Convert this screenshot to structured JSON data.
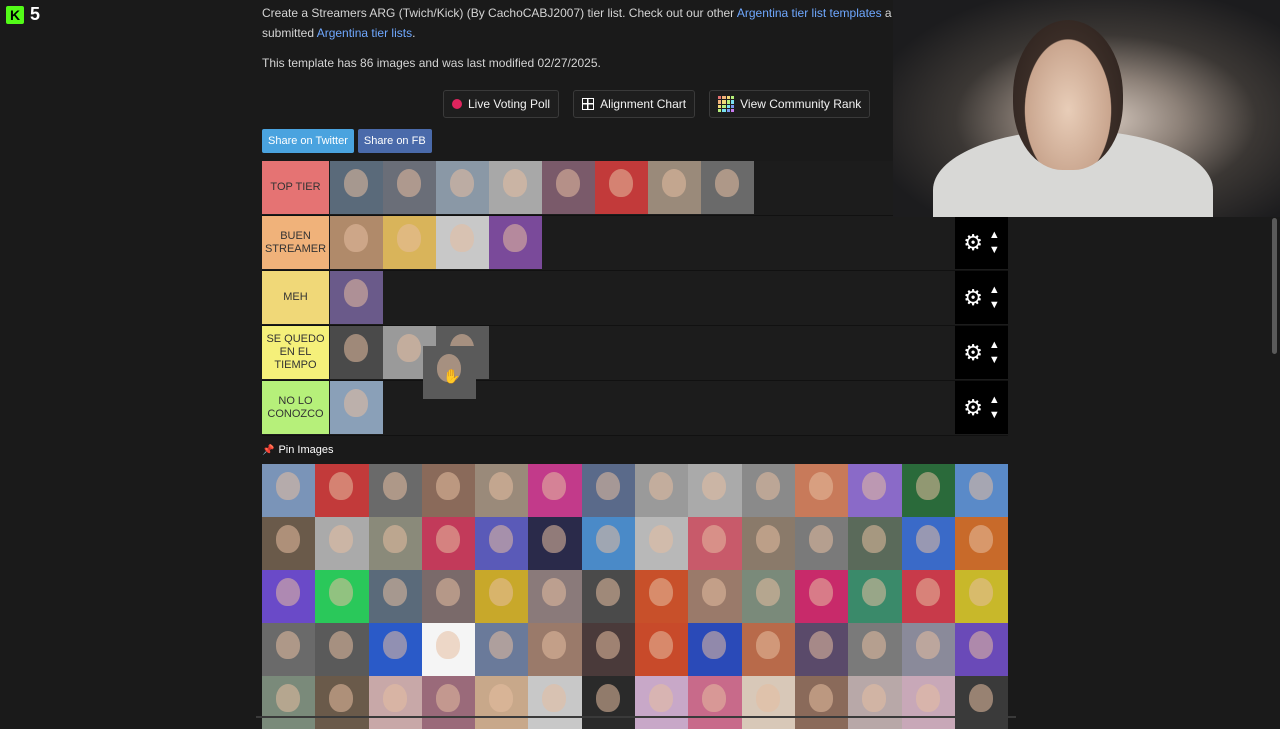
{
  "overlay": {
    "kick_count": "5",
    "kick_logo": "K"
  },
  "description": {
    "prefix": "Create a Streamers ARG (Twich/Kick) (By CachoCABJ2007) tier list. Check out our other ",
    "link1": "Argentina tier list templates",
    "middle": " and the r",
    "line2_prefix": "submitted ",
    "link2": "Argentina tier lists",
    "line2_suffix": "."
  },
  "meta_text": "This template has 86 images and was last modified 02/27/2025.",
  "toolbar": {
    "live_voting": "Live Voting Poll",
    "alignment_chart": "Alignment Chart",
    "community_rank": "View Community Rank"
  },
  "share": {
    "twitter": "Share on Twitter",
    "facebook": "Share on FB"
  },
  "tiers": [
    {
      "label": "TOP TIER",
      "color": "#e57373",
      "items": [
        "#5a6a7a",
        "#6a6e78",
        "#8a98a6",
        "#a8a8a8",
        "#7a5a6a",
        "#c23a3a",
        "#9a8a7a",
        "#6a6a6a"
      ]
    },
    {
      "label": "BUEN STREAMER",
      "color": "#f0b27a",
      "items": [
        "#b08a6a",
        "#d9b45a",
        "#c8c8c8",
        "#7a4a9a"
      ]
    },
    {
      "label": "MEH",
      "color": "#f0d878",
      "items": [
        "#6a5a8a"
      ]
    },
    {
      "label": "SE QUEDO EN EL TIEMPO",
      "color": "#f5f07a",
      "items": [
        "#4a4a4a",
        "#9a9a9a",
        "#5a5a5a"
      ]
    },
    {
      "label": "NO LO CONOZCO",
      "color": "#b6f07a",
      "items": [
        "#8aa0b8"
      ]
    }
  ],
  "pin_title": "Pin Images",
  "pool_colors": [
    "#7a94b8",
    "#c23a3a",
    "#6a6a6a",
    "#8a6a5a",
    "#9a8a7a",
    "#c23a8a",
    "#5a6a8a",
    "#9a9a9a",
    "#aaaaaa",
    "#8a8a8a",
    "#c87a5a",
    "#8a6ac8",
    "#2a6a3a",
    "#5a8ac8",
    "#6a5a4a",
    "#aaaaaa",
    "#8a8a7a",
    "#c23a5a",
    "#5a5ab8",
    "#2a2a4a",
    "#4a8ac8",
    "#b8b8b8",
    "#c85a6a",
    "#8a7a6a",
    "#7a7a7a",
    "#5a6a5a",
    "#3a6ac8",
    "#c86a2a",
    "#6a4ac8",
    "#2ac85a",
    "#5a6a7a",
    "#7a6a6a",
    "#c8a82a",
    "#8a7a7a",
    "#4a4a4a",
    "#c8502a",
    "#9a7a6a",
    "#7a8a7a",
    "#c82a6a",
    "#3a8a6a",
    "#c83a4a",
    "#c8b82a",
    "#6a6a6a",
    "#5a5a5a",
    "#2a5ac8",
    "#f5f5f5",
    "#6a7a9a",
    "#9a7a6a",
    "#4a3a3a",
    "#c84a2a",
    "#2a4ab8",
    "#b86a4a",
    "#5a4a6a",
    "#7a7a7a",
    "#8a8a9a",
    "#6a4ab8",
    "#7a8a7a",
    "#6a5a4a",
    "#c8a8a8",
    "#9a6a7a",
    "#c8a88a",
    "#c8c8c8",
    "#2a2a2a",
    "#c8a8c8",
    "#c86a8a",
    "#d8c8b8",
    "#8a6a5a",
    "#b8a8a8",
    "#c8a8b8",
    "#3a3a3a"
  ],
  "dragging_item_color": "#5a5a5a",
  "colors": {
    "twitter": "#4aa3df",
    "facebook": "#4a6aaa",
    "link": "#6fa8ff",
    "kick": "#53fc18"
  }
}
